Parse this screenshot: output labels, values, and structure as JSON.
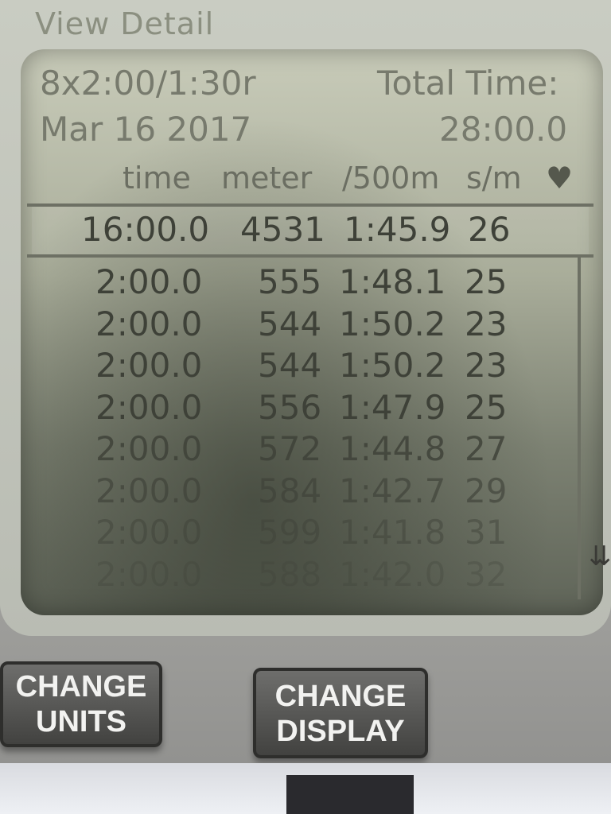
{
  "screen": {
    "title": "View Detail",
    "workout_name": "8x2:00/1:30r",
    "date": "Mar  16 2017",
    "total_time_label": "Total Time:",
    "total_time_value": "28:00.0"
  },
  "columns": {
    "time": "time",
    "meter": "meter",
    "pace": "/500m",
    "rate": "s/m",
    "heart_icon": "heart-icon"
  },
  "summary": {
    "time": "16:00.0",
    "meter": "4531",
    "pace": "1:45.9",
    "rate": "26"
  },
  "intervals": [
    {
      "time": "2:00.0",
      "meter": "555",
      "pace": "1:48.1",
      "rate": "25"
    },
    {
      "time": "2:00.0",
      "meter": "544",
      "pace": "1:50.2",
      "rate": "23"
    },
    {
      "time": "2:00.0",
      "meter": "544",
      "pace": "1:50.2",
      "rate": "23"
    },
    {
      "time": "2:00.0",
      "meter": "556",
      "pace": "1:47.9",
      "rate": "25"
    },
    {
      "time": "2:00.0",
      "meter": "572",
      "pace": "1:44.8",
      "rate": "27"
    },
    {
      "time": "2:00.0",
      "meter": "584",
      "pace": "1:42.7",
      "rate": "29"
    },
    {
      "time": "2:00.0",
      "meter": "599",
      "pace": "1:41.8",
      "rate": "31"
    },
    {
      "time": "2:00.0",
      "meter": "588",
      "pace": "1:42.0",
      "rate": "32"
    }
  ],
  "buttons": {
    "change_units_line1": "CHANGE",
    "change_units_line2": "UNITS",
    "change_display_line1": "CHANGE",
    "change_display_line2": "DISPLAY"
  },
  "icons": {
    "scroll_down": "double-chevron-down-icon"
  }
}
